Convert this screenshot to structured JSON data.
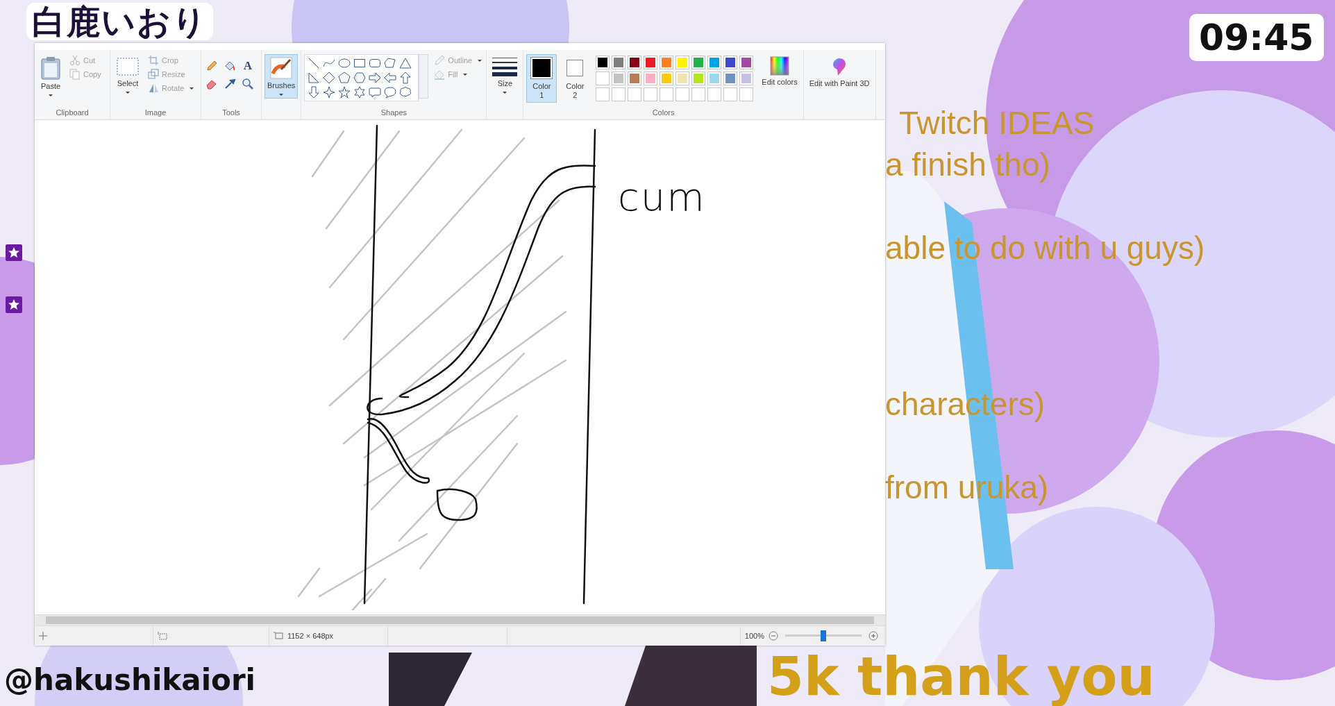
{
  "overlay": {
    "logo": "白鹿いおり",
    "clock": "09:45",
    "agenda": [
      "Twitch IDEAS",
      "a finish tho)",
      "able to do with u guys)",
      "characters)",
      "from uruka)"
    ],
    "handle": "@hakushikaiori",
    "goal": "5k thank you"
  },
  "paint": {
    "ribbon": {
      "clipboard": {
        "label": "Clipboard",
        "paste": "Paste",
        "cut": "Cut",
        "copy": "Copy"
      },
      "image": {
        "label": "Image",
        "select": "Select",
        "crop": "Crop",
        "resize": "Resize",
        "rotate": "Rotate"
      },
      "tools": {
        "label": "Tools",
        "text_tool": "A"
      },
      "brushes": {
        "label": "Brushes",
        "selected": true
      },
      "shapes": {
        "label": "Shapes",
        "outline": {
          "label": "Outline",
          "disabled": true
        },
        "fill": {
          "label": "Fill",
          "disabled": true
        }
      },
      "size": {
        "label": "Size"
      },
      "colors": {
        "label": "Colors",
        "swatches": [
          {
            "label": "Color 1",
            "color": "#000000",
            "selected": true
          },
          {
            "label": "Color 2",
            "color": "#ffffff",
            "selected": false
          }
        ],
        "palette": [
          {
            "color": "#000000"
          },
          {
            "color": "#7f7f7f"
          },
          {
            "color": "#880015"
          },
          {
            "color": "#ed1c24"
          },
          {
            "color": "#ff7f27"
          },
          {
            "color": "#fff200"
          },
          {
            "color": "#22b14c"
          },
          {
            "color": "#00a2e8"
          },
          {
            "color": "#3f48cc"
          },
          {
            "color": "#a349a4"
          },
          {
            "color": "#ffffff"
          },
          {
            "color": "#c3c3c3"
          },
          {
            "color": "#b97a57"
          },
          {
            "color": "#ffaec9"
          },
          {
            "color": "#ffc90e"
          },
          {
            "color": "#efe4b0"
          },
          {
            "color": "#b5e61d"
          },
          {
            "color": "#99d9ea"
          },
          {
            "color": "#7092be"
          },
          {
            "color": "#c8bfe7"
          }
        ],
        "edit_colors": "Edit colors"
      },
      "paint3d": "Edit with Paint 3D"
    },
    "canvas": {
      "note": "cum"
    },
    "status_bar": {
      "dimensions": "1152 × 648px",
      "zoom": "100%",
      "zoom_slider": {
        "level": 0.5
      }
    }
  }
}
